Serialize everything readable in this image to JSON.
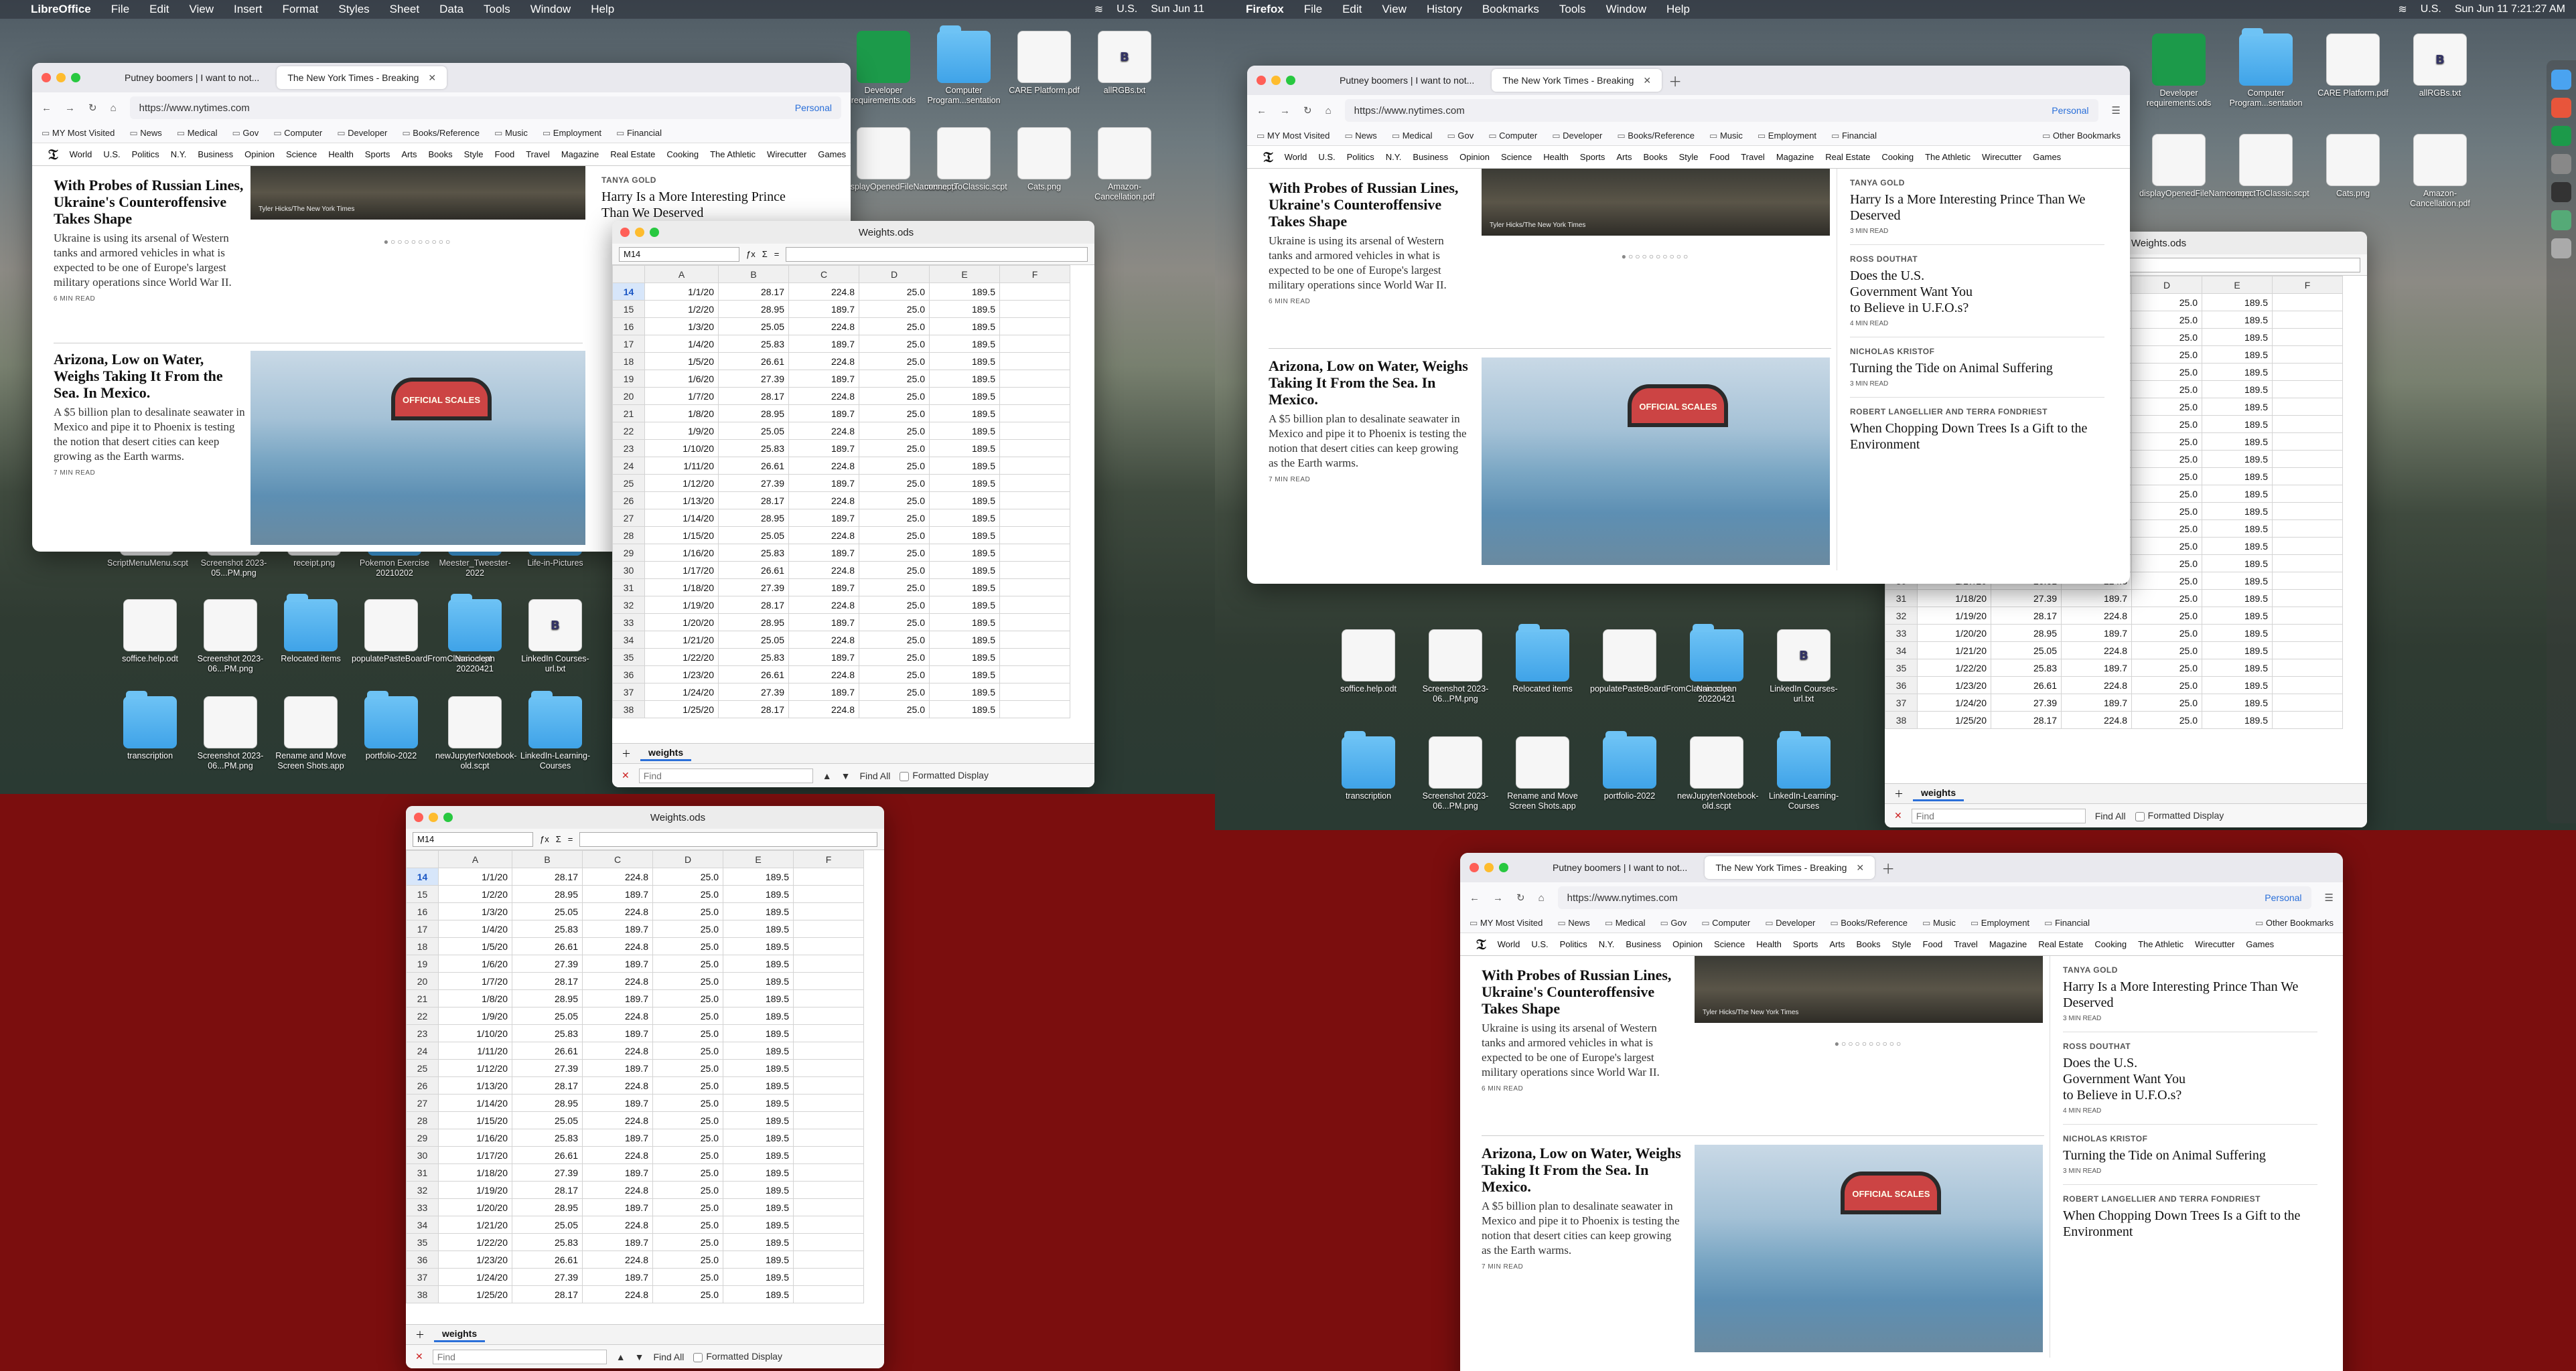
{
  "colors": {
    "accent": "#2a6fd9",
    "desktop_red": "#7b0e0e"
  },
  "menubar_left": {
    "app": "LibreOffice",
    "items": [
      "File",
      "Edit",
      "View",
      "Insert",
      "Format",
      "Styles",
      "Sheet",
      "Data",
      "Tools",
      "Window",
      "Help"
    ],
    "right": {
      "input": "U.S.",
      "date": "Sun Jun 11"
    }
  },
  "menubar_right": {
    "app": "Firefox",
    "items": [
      "File",
      "Edit",
      "View",
      "History",
      "Bookmarks",
      "Tools",
      "Window",
      "Help"
    ],
    "right": {
      "input": "U.S.",
      "date": "Sun Jun 11  7:21:27 AM"
    }
  },
  "browser": {
    "tabs": [
      {
        "label": "Putney boomers | I want to not..."
      },
      {
        "label": "The New York Times - Breaking"
      }
    ],
    "url": "https://www.nytimes.com",
    "personal": "Personal",
    "bookmarks": [
      "MY Most Visited",
      "News",
      "Medical",
      "Gov",
      "Computer",
      "Developer",
      "Books/Reference",
      "Music",
      "Employment",
      "Financial"
    ],
    "other_bookmarks": "Other Bookmarks",
    "nyt_nav": [
      "World",
      "U.S.",
      "Politics",
      "N.Y.",
      "Business",
      "Opinion",
      "Science",
      "Health",
      "Sports",
      "Arts",
      "Books",
      "Style",
      "Food",
      "Travel",
      "Magazine",
      "Real Estate",
      "Cooking",
      "The Athletic",
      "Wirecutter",
      "Games"
    ],
    "stories": [
      {
        "headline": "With Probes of Russian Lines, Ukraine's Counteroffensive Takes Shape",
        "summary": "Ukraine is using its arsenal of Western tanks and armored vehicles in what is expected to be one of Europe's largest military operations since World War II.",
        "read": "6 MIN READ",
        "photo_credit": "Tyler Hicks/The New York Times"
      },
      {
        "headline": "Arizona, Low on Water, Weighs Taking It From the Sea. In Mexico.",
        "summary": "A $5 billion plan to desalinate seawater in Mexico and pipe it to Phoenix is testing the notion that desert cities can keep growing as the Earth warms.",
        "read": "7 MIN READ",
        "sign": "OFFICIAL SCALES"
      }
    ],
    "opinion": [
      {
        "byline": "TANYA GOLD",
        "headline": "Harry Is a More Interesting Prince Than We Deserved",
        "read": "3 MIN READ"
      },
      {
        "byline": "ROSS DOUTHAT",
        "headline": "Does the U.S. Government Want You to Believe in U.F.O.s?",
        "read": "4 MIN READ"
      },
      {
        "byline": "NICHOLAS KRISTOF",
        "headline": "Turning the Tide on Animal Suffering",
        "read": "3 MIN READ"
      },
      {
        "byline": "ROBERT LANGELLIER AND TERRA FONDRIEST",
        "headline": "When Chopping Down Trees Is a Gift to the Environment"
      }
    ]
  },
  "calc": {
    "title": "Weights.ods",
    "namebox": "M14",
    "sheet": "weights",
    "find_placeholder": "Find",
    "find_all": "Find All",
    "formatted": "Formatted Display",
    "columns": [
      "A",
      "B",
      "C",
      "D",
      "E",
      "F"
    ],
    "rows": [
      [
        14,
        "1/1/20",
        "28.17",
        "224.8",
        "25.0",
        "189.5"
      ],
      [
        15,
        "1/2/20",
        "28.95",
        "189.7",
        "25.0",
        "189.5"
      ],
      [
        16,
        "1/3/20",
        "25.05",
        "224.8",
        "25.0",
        "189.5"
      ],
      [
        17,
        "1/4/20",
        "25.83",
        "189.7",
        "25.0",
        "189.5"
      ],
      [
        18,
        "1/5/20",
        "26.61",
        "224.8",
        "25.0",
        "189.5"
      ],
      [
        19,
        "1/6/20",
        "27.39",
        "189.7",
        "25.0",
        "189.5"
      ],
      [
        20,
        "1/7/20",
        "28.17",
        "224.8",
        "25.0",
        "189.5"
      ],
      [
        21,
        "1/8/20",
        "28.95",
        "189.7",
        "25.0",
        "189.5"
      ],
      [
        22,
        "1/9/20",
        "25.05",
        "224.8",
        "25.0",
        "189.5"
      ],
      [
        23,
        "1/10/20",
        "25.83",
        "189.7",
        "25.0",
        "189.5"
      ],
      [
        24,
        "1/11/20",
        "26.61",
        "224.8",
        "25.0",
        "189.5"
      ],
      [
        25,
        "1/12/20",
        "27.39",
        "189.7",
        "25.0",
        "189.5"
      ],
      [
        26,
        "1/13/20",
        "28.17",
        "224.8",
        "25.0",
        "189.5"
      ],
      [
        27,
        "1/14/20",
        "28.95",
        "189.7",
        "25.0",
        "189.5"
      ],
      [
        28,
        "1/15/20",
        "25.05",
        "224.8",
        "25.0",
        "189.5"
      ],
      [
        29,
        "1/16/20",
        "25.83",
        "189.7",
        "25.0",
        "189.5"
      ],
      [
        30,
        "1/17/20",
        "26.61",
        "224.8",
        "25.0",
        "189.5"
      ],
      [
        31,
        "1/18/20",
        "27.39",
        "189.7",
        "25.0",
        "189.5"
      ],
      [
        32,
        "1/19/20",
        "28.17",
        "224.8",
        "25.0",
        "189.5"
      ],
      [
        33,
        "1/20/20",
        "28.95",
        "189.7",
        "25.0",
        "189.5"
      ],
      [
        34,
        "1/21/20",
        "25.05",
        "224.8",
        "25.0",
        "189.5"
      ],
      [
        35,
        "1/22/20",
        "25.83",
        "189.7",
        "25.0",
        "189.5"
      ],
      [
        36,
        "1/23/20",
        "26.61",
        "224.8",
        "25.0",
        "189.5"
      ],
      [
        37,
        "1/24/20",
        "27.39",
        "189.7",
        "25.0",
        "189.5"
      ],
      [
        38,
        "1/25/20",
        "28.17",
        "224.8",
        "25.0",
        "189.5"
      ]
    ]
  },
  "desktop_icons": [
    {
      "label": "Developer requirements.ods",
      "kind": "green"
    },
    {
      "label": "Computer Program...sentation",
      "kind": "folder"
    },
    {
      "label": "CARE Platform.pdf",
      "kind": "doc"
    },
    {
      "label": "allRGBs.txt",
      "kind": "txt"
    },
    {
      "label": "displayOpenedFileNames.app",
      "kind": "doc"
    },
    {
      "label": "connectToClassic.scpt",
      "kind": "doc"
    },
    {
      "label": "Cats.png",
      "kind": "doc"
    },
    {
      "label": "Amazon-Cancellation.pdf",
      "kind": "doc"
    },
    {
      "label": "ScriptMenuMenu.scpt",
      "kind": "doc"
    },
    {
      "label": "Screenshot 2023-05...PM.png",
      "kind": "doc"
    },
    {
      "label": "receipt.png",
      "kind": "doc"
    },
    {
      "label": "Pokemon Exercise 20210202",
      "kind": "folder"
    },
    {
      "label": "Meester_Tweester-2022",
      "kind": "folder"
    },
    {
      "label": "Life-in-Pictures",
      "kind": "folder"
    },
    {
      "label": "soffice.help.odt",
      "kind": "doc"
    },
    {
      "label": "Screenshot 2023-06...PM.png",
      "kind": "doc"
    },
    {
      "label": "Relocated items",
      "kind": "folder"
    },
    {
      "label": "populatePasteBoardFromClassic.scpt",
      "kind": "doc"
    },
    {
      "label": "Nanoclean 20220421",
      "kind": "folder"
    },
    {
      "label": "LinkedIn Courses-url.txt",
      "kind": "txt"
    },
    {
      "label": "transcription",
      "kind": "folder"
    },
    {
      "label": "Screenshot 2023-06...PM.png",
      "kind": "doc"
    },
    {
      "label": "Rename and Move Screen Shots.app",
      "kind": "doc"
    },
    {
      "label": "portfolio-2022",
      "kind": "folder"
    },
    {
      "label": "newJupyterNotebook-old.scpt",
      "kind": "doc"
    },
    {
      "label": "LinkedIn-Learning-Courses",
      "kind": "folder"
    }
  ]
}
